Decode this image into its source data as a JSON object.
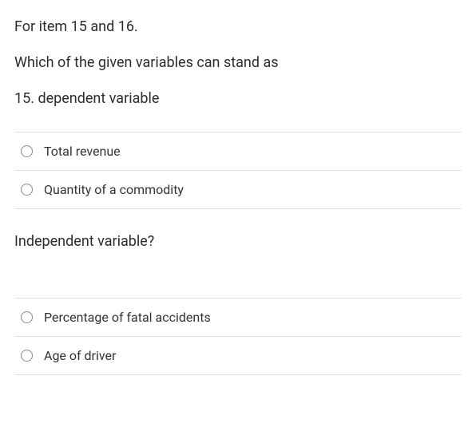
{
  "question": {
    "intro": "For item 15 and 16.",
    "stem": "Which of the given variables can stand as",
    "part1": "15. dependent variable"
  },
  "group1": {
    "options": [
      {
        "label": "Total revenue"
      },
      {
        "label": "Quantity of a commodity"
      }
    ]
  },
  "heading2": "Independent variable?",
  "group2": {
    "options": [
      {
        "label": "Percentage of fatal accidents"
      },
      {
        "label": "Age of driver"
      }
    ]
  }
}
